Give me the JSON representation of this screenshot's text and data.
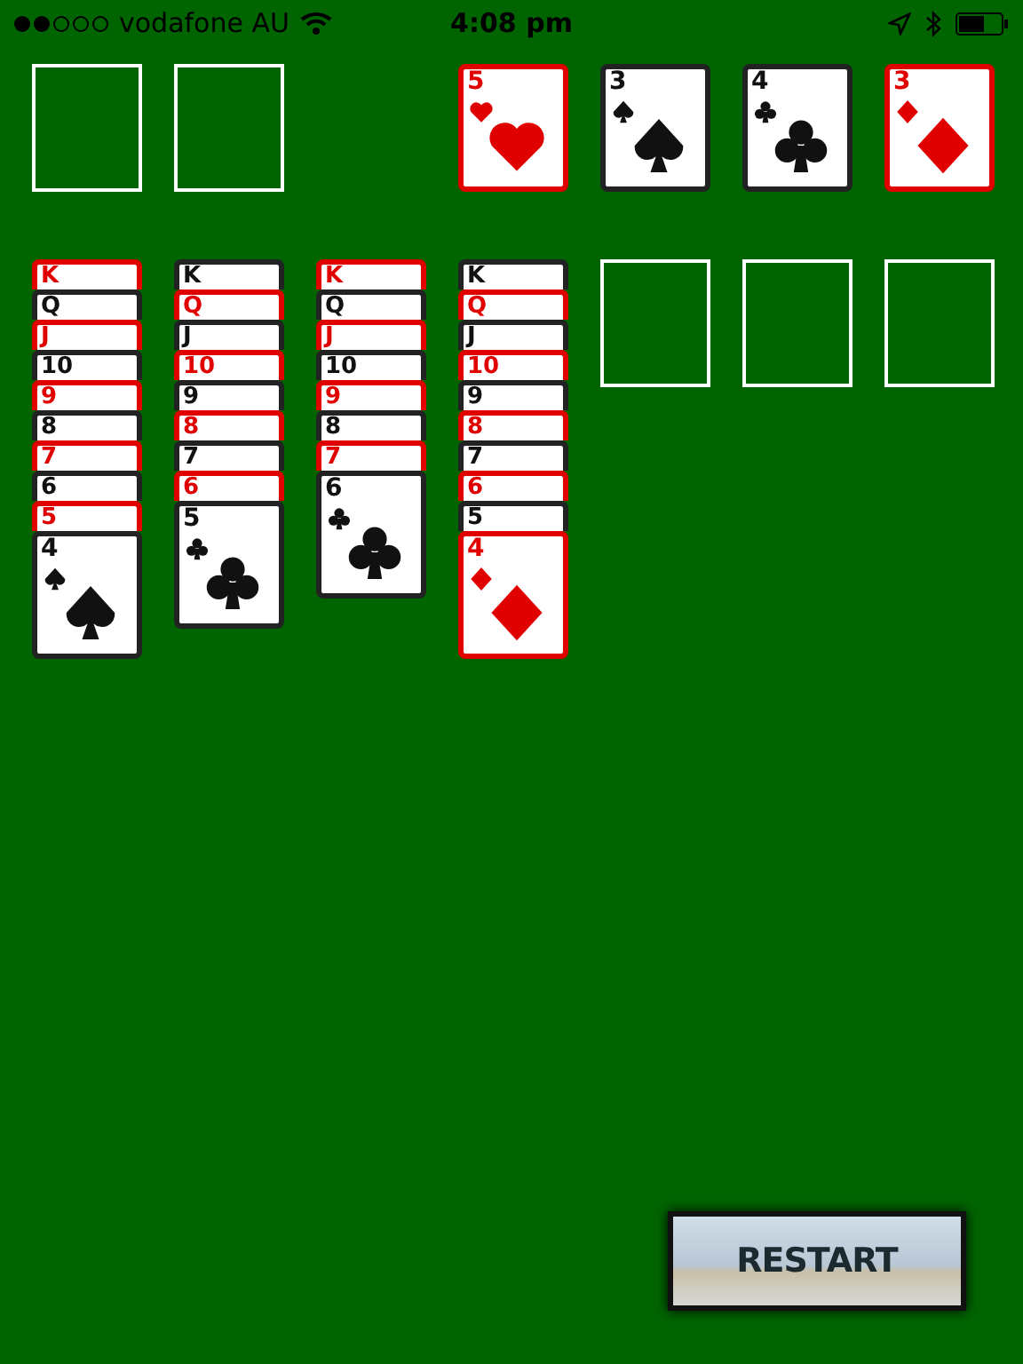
{
  "status_bar": {
    "carrier": "vodafone AU",
    "time": "4:08 pm"
  },
  "foundations": [
    {
      "rank": "5",
      "kind": "hearts"
    },
    {
      "rank": "3",
      "kind": "spades"
    },
    {
      "rank": "4",
      "kind": "clubs"
    },
    {
      "rank": "3",
      "kind": "diamonds"
    }
  ],
  "tableau": [
    {
      "cards": [
        {
          "rank": "K",
          "red": true
        },
        {
          "rank": "Q",
          "red": false
        },
        {
          "rank": "J",
          "red": true
        },
        {
          "rank": "10",
          "red": false
        },
        {
          "rank": "9",
          "red": true
        },
        {
          "rank": "8",
          "red": false
        },
        {
          "rank": "7",
          "red": true
        },
        {
          "rank": "6",
          "red": false
        },
        {
          "rank": "5",
          "red": true
        },
        {
          "rank": "4",
          "kind": "spades"
        }
      ]
    },
    {
      "cards": [
        {
          "rank": "K",
          "red": false
        },
        {
          "rank": "Q",
          "red": true
        },
        {
          "rank": "J",
          "red": false
        },
        {
          "rank": "10",
          "red": true
        },
        {
          "rank": "9",
          "red": false
        },
        {
          "rank": "8",
          "red": true
        },
        {
          "rank": "7",
          "red": false
        },
        {
          "rank": "6",
          "red": true
        },
        {
          "rank": "5",
          "kind": "clubs"
        }
      ]
    },
    {
      "cards": [
        {
          "rank": "K",
          "red": true
        },
        {
          "rank": "Q",
          "red": false
        },
        {
          "rank": "J",
          "red": true
        },
        {
          "rank": "10",
          "red": false
        },
        {
          "rank": "9",
          "red": true
        },
        {
          "rank": "8",
          "red": false
        },
        {
          "rank": "7",
          "red": true
        },
        {
          "rank": "6",
          "kind": "clubs"
        }
      ]
    },
    {
      "cards": [
        {
          "rank": "K",
          "red": false
        },
        {
          "rank": "Q",
          "red": true
        },
        {
          "rank": "J",
          "red": false
        },
        {
          "rank": "10",
          "red": true
        },
        {
          "rank": "9",
          "red": false
        },
        {
          "rank": "8",
          "red": true
        },
        {
          "rank": "7",
          "red": false
        },
        {
          "rank": "6",
          "red": true
        },
        {
          "rank": "5",
          "red": false
        },
        {
          "rank": "4",
          "kind": "diamonds"
        }
      ]
    }
  ],
  "restart_button": {
    "label": "RESTART"
  }
}
